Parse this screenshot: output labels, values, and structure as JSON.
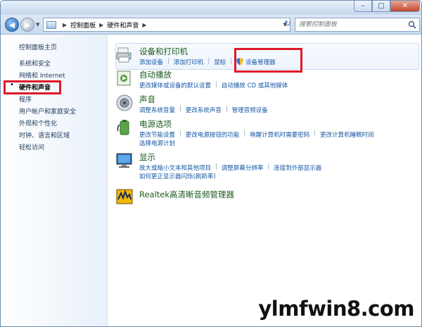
{
  "window": {
    "buttons": {
      "minimize": "–",
      "maximize": "□",
      "close": "✕"
    }
  },
  "navigation": {
    "back_symbol": "◀",
    "forward_symbol": "▶",
    "breadcrumb": [
      "控制面板",
      "硬件和声音"
    ],
    "search_placeholder": "搜索控制面板"
  },
  "sidebar": {
    "items": [
      {
        "label": "控制面板主页",
        "active": false
      },
      {
        "label": "系统和安全",
        "active": false
      },
      {
        "label": "网络和 Internet",
        "active": false
      },
      {
        "label": "硬件和声音",
        "active": true
      },
      {
        "label": "程序",
        "active": false
      },
      {
        "label": "用户帐户和家庭安全",
        "active": false
      },
      {
        "label": "外观和个性化",
        "active": false
      },
      {
        "label": "时钟、语言和区域",
        "active": false
      },
      {
        "label": "轻松访问",
        "active": false
      }
    ],
    "bullet": "•"
  },
  "categories": [
    {
      "id": "devices",
      "icon": "printer-icon",
      "title": "设备和打印机",
      "links": [
        "添加设备",
        "添加打印机",
        "鼠标",
        "设备管理器"
      ]
    },
    {
      "id": "autoplay",
      "icon": "autoplay-icon",
      "title": "自动播放",
      "links": [
        "更改媒体或设备的默认设置",
        "自动播放 CD 或其他媒体"
      ]
    },
    {
      "id": "sound",
      "icon": "speaker-icon",
      "title": "声音",
      "links": [
        "调整系统音量",
        "更改系统声音",
        "管理音频设备"
      ]
    },
    {
      "id": "power",
      "icon": "battery-icon",
      "title": "电源选项",
      "links": [
        "更改节能设置",
        "更改电源按钮的功能",
        "唤醒计算机时需要密码",
        "更改计算机睡眠时间"
      ],
      "links2": [
        "选择电源计划"
      ]
    },
    {
      "id": "display",
      "icon": "monitor-icon",
      "title": "显示",
      "links": [
        "放大或缩小文本和其他项目",
        "调整屏幕分辨率",
        "连接到外部显示器"
      ],
      "links2": [
        "如何更正显示器闪烁(刷新率)"
      ]
    },
    {
      "id": "realtek",
      "icon": "realtek-audio-icon",
      "title": "Realtek高清晰音频管理器",
      "links": []
    }
  ],
  "watermark": "ylmfwin8.com",
  "colors": {
    "highlight": "#e0192a",
    "link": "#1657a3",
    "title": "#1a5b1f"
  }
}
